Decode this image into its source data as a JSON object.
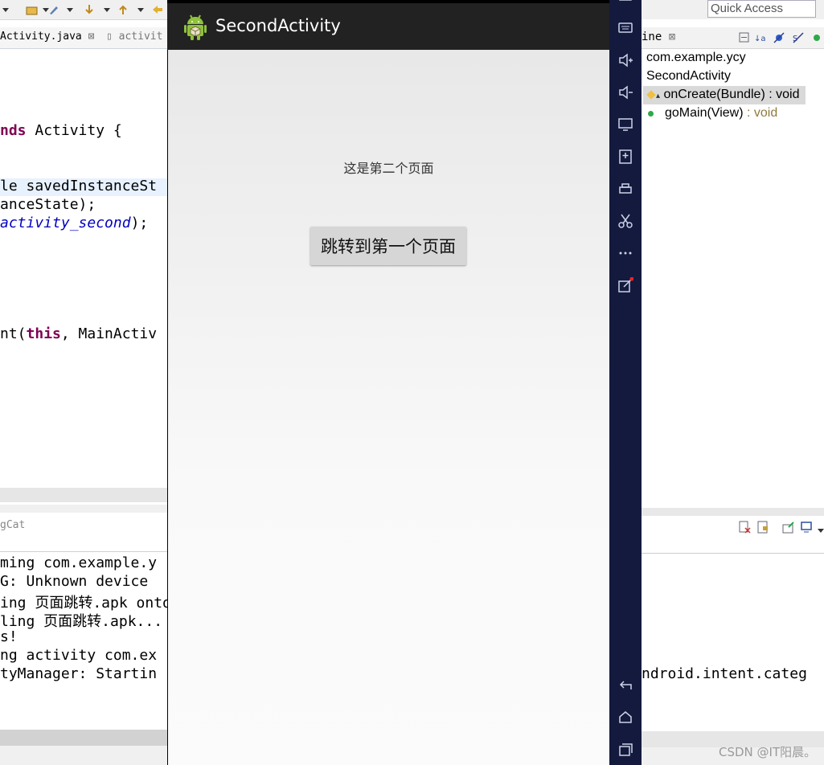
{
  "editor": {
    "tabs": [
      "Activity.java",
      "activit"
    ],
    "code_lines": [
      {
        "pre": "",
        "kw": "nds",
        "post": " Activity {"
      },
      {
        "pre": "le savedInstanceSt",
        "kw": "",
        "post": ""
      },
      {
        "pre": "anceState);",
        "kw": "",
        "post": ""
      },
      {
        "pre": "",
        "it": "activity_second",
        "post": ");"
      },
      {
        "pre": "nt(",
        "kw": "this",
        "post": ", MainActiv"
      }
    ]
  },
  "logcat": {
    "tab_label": "gCat",
    "lines": [
      "ming com.example.y",
      "G: Unknown device",
      "ing 页面跳转.apk onto",
      "ling 页面跳转.apk...",
      "s!",
      "ng activity com.ex",
      "tyManager: Startin"
    ]
  },
  "app": {
    "title": "SecondActivity",
    "page_text": "这是第二个页面",
    "button_label": "跳转到第一个页面"
  },
  "emulator_toolbar": [
    "device-icon",
    "keyboard-icon",
    "volume-up-icon",
    "volume-down-icon",
    "screen-icon",
    "install-apk-icon",
    "print-icon",
    "scissors-icon",
    "more-icon",
    "external-icon",
    "back-icon",
    "home-icon",
    "recents-icon"
  ],
  "quick_access": {
    "placeholder": "Quick Access"
  },
  "outline": {
    "tab_label": "ine",
    "items": [
      {
        "label": "com.example.ycy"
      },
      {
        "label": "SecondActivity"
      },
      {
        "label": "onCreate(Bundle)",
        "ret": " : void"
      },
      {
        "label": "goMain(View)",
        "ret": " : void"
      }
    ]
  },
  "right_log_fragment": "ndroid.intent.categ",
  "watermark": "CSDN @IT阳晨。",
  "colors": {
    "action_bar": "#222222",
    "side_bar": "#131a3e",
    "keyword": "#7f0055",
    "field": "#0000c0"
  }
}
